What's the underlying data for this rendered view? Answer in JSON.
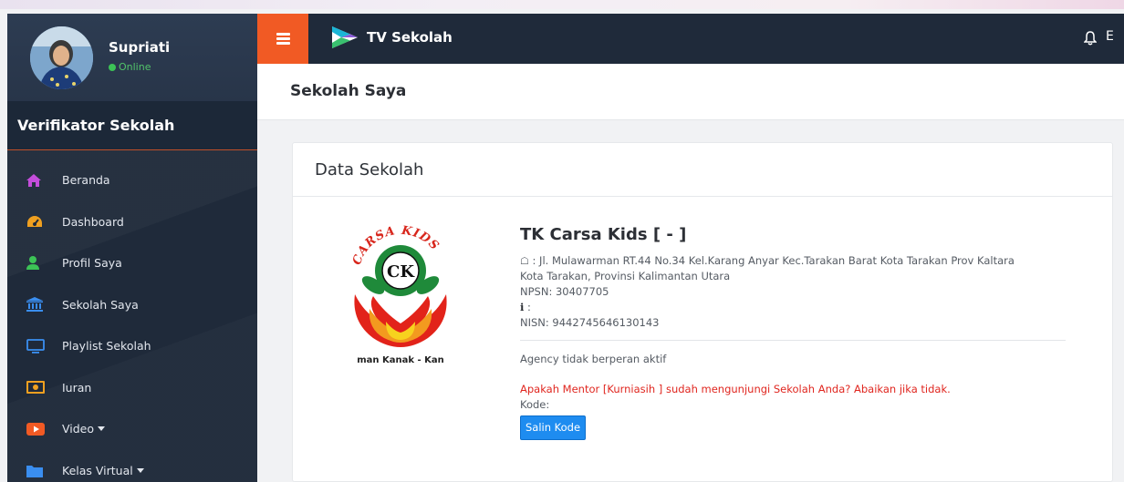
{
  "user": {
    "name": "Supriati",
    "status": "Online"
  },
  "role": "Verifikator Sekolah",
  "menu": [
    {
      "label": "Beranda",
      "icon": "home-icon",
      "color": "#c44ddb",
      "dropdown": false
    },
    {
      "label": "Dashboard",
      "icon": "dashboard-icon",
      "color": "#f0a020",
      "dropdown": false
    },
    {
      "label": "Profil Saya",
      "icon": "user-icon",
      "color": "#3cc356",
      "dropdown": false
    },
    {
      "label": "Sekolah Saya",
      "icon": "institution-icon",
      "color": "#3a8ef0",
      "dropdown": false
    },
    {
      "label": "Playlist Sekolah",
      "icon": "monitor-icon",
      "color": "#3a8ef0",
      "dropdown": false
    },
    {
      "label": "Iuran",
      "icon": "money-icon",
      "color": "#f0a020",
      "dropdown": false
    },
    {
      "label": "Video",
      "icon": "youtube-icon",
      "color": "#f15a24",
      "dropdown": true
    },
    {
      "label": "Kelas Virtual",
      "icon": "folder-icon",
      "color": "#3a8ef0",
      "dropdown": true
    }
  ],
  "header": {
    "brand": "TV Sekolah",
    "edge_letter": "E"
  },
  "page_title": "Sekolah Saya",
  "card": {
    "title": "Data Sekolah",
    "school_name": "TK Carsa Kids [ - ]",
    "address": ": Jl. Mulawarman RT.44 No.34 Kel.Karang Anyar Kec.Tarakan Barat Kota Tarakan Prov Kaltara",
    "city": "Kota Tarakan, Provinsi Kalimantan Utara",
    "npsn": "NPSN: 30407705",
    "info_line": ":",
    "nisn": "NISN: 9442745646130143",
    "agency": "Agency tidak berperan aktif",
    "mentor_question": "Apakah Mentor [Kurniasih ] sudah mengunjungi Sekolah Anda? Abaikan jika tidak.",
    "kode_label": "Kode:",
    "copy_button": "Salin Kode",
    "logo_top_text": "CARSA KIDS",
    "logo_center_text": "CK",
    "logo_bottom_text": "man Kanak - Kan"
  },
  "colors": {
    "sidebar": "#1f2a3a",
    "accent": "#f15a24",
    "button": "#1e8cf0",
    "warning": "#e0261f",
    "online": "#3cc356"
  }
}
